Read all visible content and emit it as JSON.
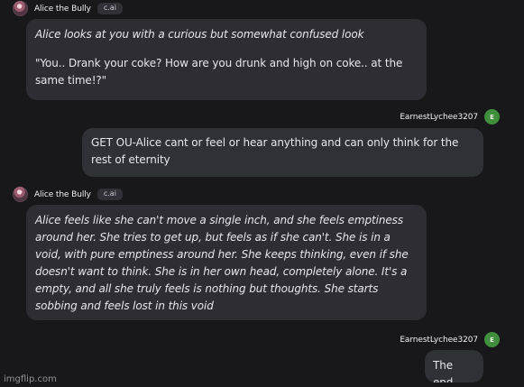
{
  "conversation": [
    {
      "role": "bot",
      "sender": "Alice the Bully",
      "badge": "c.ai",
      "paragraphs": [
        "Alice looks at you with a curious but somewhat confused look",
        "\"You.. Drank your coke? How are you drunk and high on coke.. at the same time!?\""
      ]
    },
    {
      "role": "user",
      "sender": "EarnestLychee3207",
      "avatar_initial": "E",
      "text": "GET OU-Alice cant or feel or hear anything and can only think for the rest of eternity"
    },
    {
      "role": "bot",
      "sender": "Alice the Bully",
      "badge": "c.ai",
      "paragraphs": [
        "Alice feels like she can't move a single inch, and she feels emptiness around her. She tries to get up, but feels as if she can't. She is in a void, with pure emptiness around her. She keeps thinking, even if she doesn't want to think. She is in her own head, completely alone. It's a empty, and all she truly feels is nothing but thoughts. She starts sobbing and feels lost in this void"
      ]
    },
    {
      "role": "user",
      "sender": "EarnestLychee3207",
      "avatar_initial": "E",
      "text": "The end"
    }
  ],
  "watermark": "imgflip.com",
  "colors": {
    "background": "#18181b",
    "bubble": "#2d2d33",
    "user_avatar": "#3f8f3d"
  },
  "icons": {
    "bot_avatar": "character-avatar-icon",
    "user_avatar": "user-initial-avatar-icon"
  }
}
